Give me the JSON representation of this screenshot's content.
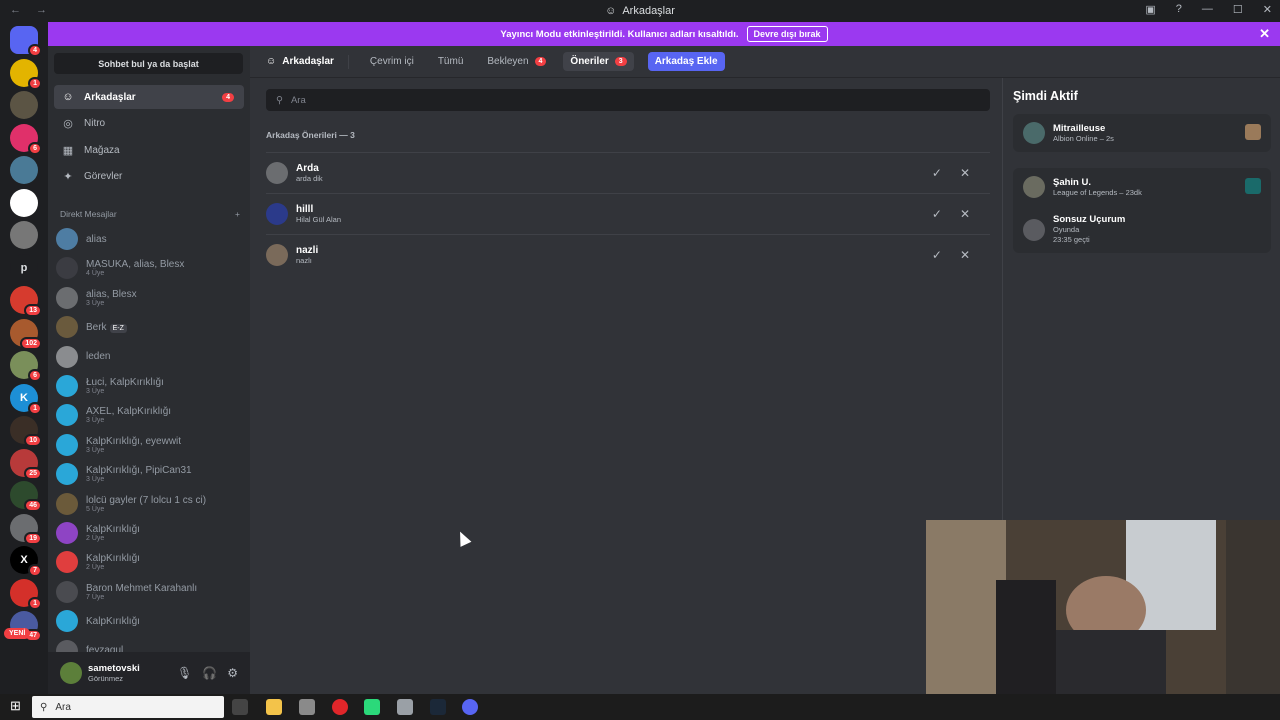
{
  "window": {
    "title": "Arkadaşlar"
  },
  "banner": {
    "text": "Yayıncı Modu etkinleştirildi. Kullanıcı adları kısaltıldı.",
    "button": "Devre dışı bırak"
  },
  "sidebar": {
    "search": "Sohbet bul ya da başlat",
    "nav": [
      {
        "label": "Arkadaşlar",
        "icon": "friends-icon",
        "badge": "4"
      },
      {
        "label": "Nitro",
        "icon": "nitro-icon"
      },
      {
        "label": "Mağaza",
        "icon": "shop-icon"
      },
      {
        "label": "Görevler",
        "icon": "quests-icon"
      }
    ],
    "dm_header": "Direkt Mesajlar",
    "dm_add": "+",
    "dms": [
      {
        "name": "alias",
        "sub": "",
        "color": "#4e7da3"
      },
      {
        "name": "MASUKA, alias, Blesx",
        "sub": "4 Üye",
        "color": "#3b3c42"
      },
      {
        "name": "alias, Blesx",
        "sub": "3 Üye",
        "color": "#6b6d70"
      },
      {
        "name": "Berk",
        "sub": "",
        "tag": "E-Z",
        "color": "#6a5a3d"
      },
      {
        "name": "leden",
        "sub": "",
        "color": "#8a8c8f"
      },
      {
        "name": "Łuci, KalpKırıklığı",
        "sub": "3 Üye",
        "color": "#2aa7d8"
      },
      {
        "name": "AXEL, KalpKırıklığı",
        "sub": "3 Üye",
        "color": "#2aa7d8"
      },
      {
        "name": "KalpKırıklığı, eyewwit",
        "sub": "3 Üye",
        "color": "#2aa7d8"
      },
      {
        "name": "KalpKırıklığı, PipiCan31",
        "sub": "3 Üye",
        "color": "#2aa7d8"
      },
      {
        "name": "lolcü gayler (7 lolcu 1 cs ci)",
        "sub": "5 Üye",
        "color": "#6b5a3a"
      },
      {
        "name": "KalpKırıklığı",
        "sub": "2 Üye",
        "color": "#8e44c4"
      },
      {
        "name": "KalpKırıklığı",
        "sub": "2 Üye",
        "color": "#e03e3e"
      },
      {
        "name": "Baron Mehmet Karahanlı",
        "sub": "7 Üye",
        "color": "#4a4b50"
      },
      {
        "name": "KalpKırıklığı",
        "sub": "",
        "color": "#2aa7d8"
      },
      {
        "name": "feyzagul",
        "sub": "",
        "color": "#5a5b60"
      }
    ],
    "user": {
      "name": "sametovski",
      "status": "Görünmez"
    }
  },
  "servers": {
    "yeni": "YENİ",
    "items": [
      {
        "label": "",
        "badge": "4",
        "color": "#5865f2"
      },
      {
        "label": "",
        "badge": "1",
        "color": "#e3b400"
      },
      {
        "label": "",
        "badge": "",
        "color": "#5b5444"
      },
      {
        "label": "",
        "badge": "6",
        "color": "#e0306a"
      },
      {
        "label": "",
        "badge": "",
        "color": "#4a7a96"
      },
      {
        "label": "",
        "badge": "",
        "color": "#ffffff"
      },
      {
        "label": "",
        "badge": "",
        "color": "#777777"
      },
      {
        "label": "p",
        "badge": "",
        "color": "#1e1f22"
      },
      {
        "label": "",
        "badge": "13",
        "color": "#d63b2e"
      },
      {
        "label": "",
        "badge": "102",
        "color": "#a85a2e"
      },
      {
        "label": "",
        "badge": "6",
        "color": "#7a8f5a"
      },
      {
        "label": "K",
        "badge": "1",
        "color": "#1d8fd6"
      },
      {
        "label": "",
        "badge": "10",
        "color": "#3a2e26"
      },
      {
        "label": "",
        "badge": "25",
        "color": "#b83a3a"
      },
      {
        "label": "",
        "badge": "46",
        "color": "#2d4a2d"
      },
      {
        "label": "",
        "badge": "19",
        "color": "#6b6d70"
      },
      {
        "label": "X",
        "badge": "7",
        "color": "#000000"
      },
      {
        "label": "",
        "badge": "1",
        "color": "#d4302a"
      },
      {
        "label": "",
        "badge": "47",
        "color": "#4a5aa0"
      }
    ]
  },
  "topbar": {
    "title": "Arkadaşlar",
    "tabs": [
      {
        "label": "Çevrim içi",
        "badge": ""
      },
      {
        "label": "Tümü",
        "badge": ""
      },
      {
        "label": "Bekleyen",
        "badge": "4"
      },
      {
        "label": "Öneriler",
        "badge": "3",
        "selected": true
      }
    ],
    "add": "Arkadaş Ekle"
  },
  "search": {
    "placeholder": "Ara"
  },
  "suggestions": {
    "title": "Arkadaş Önerileri — 3",
    "items": [
      {
        "name": "Arda",
        "sub": "arda dik",
        "color": "#6b6d70"
      },
      {
        "name": "hilll",
        "sub": "Hilal Gül Alan",
        "color": "#2b3a8a"
      },
      {
        "name": "nazli",
        "sub": "nazlı",
        "color": "#7a6a5a"
      }
    ]
  },
  "active_now": {
    "title": "Şimdi Aktif",
    "cards": [
      {
        "entries": [
          {
            "name": "Mitrailleuse",
            "sub": "Albion Online – 2s",
            "color": "#4a6a6a",
            "game_color": "#9a7a5a"
          }
        ]
      },
      {
        "entries": [
          {
            "name": "Şahin U.",
            "sub": "League of Legends – 23dk",
            "color": "#6a6b60",
            "game_color": "#1a6a6a"
          },
          {
            "name": "Sonsuz Uçurum",
            "sub": "Oyunda",
            "sub2": "23:35 geçti",
            "color": "#5a5b60"
          }
        ]
      }
    ]
  },
  "taskbar": {
    "search": "Ara"
  }
}
